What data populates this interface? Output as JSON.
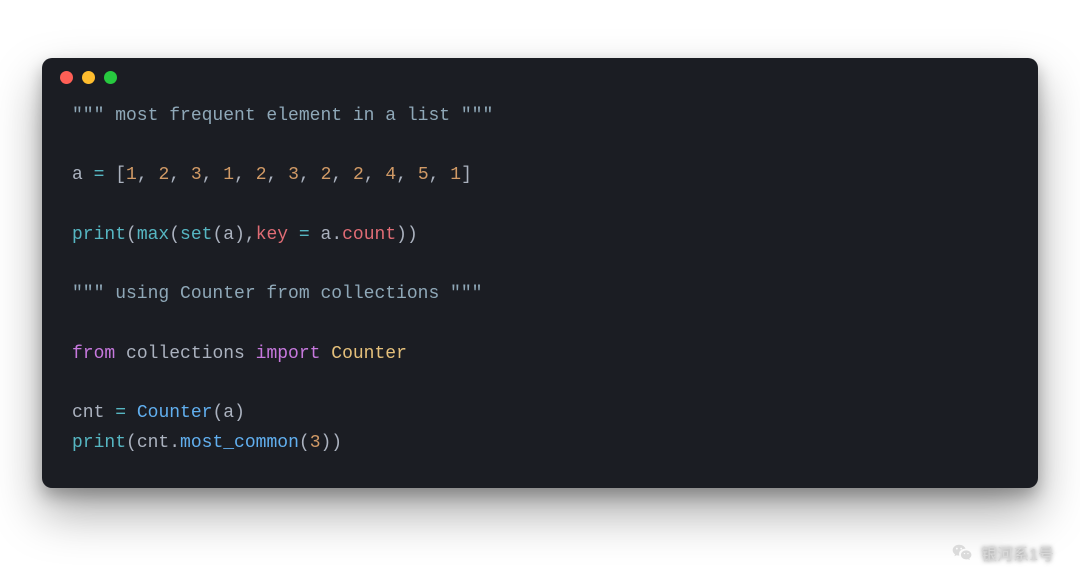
{
  "window": {
    "dots": [
      "red",
      "yellow",
      "green"
    ]
  },
  "code": {
    "lines": [
      [
        {
          "cls": "tok-string",
          "t": "\"\"\" most frequent element in a list \"\"\""
        }
      ],
      [],
      [
        {
          "cls": "tok-plain",
          "t": "a "
        },
        {
          "cls": "tok-op",
          "t": "="
        },
        {
          "cls": "tok-plain",
          "t": " ["
        },
        {
          "cls": "tok-num",
          "t": "1"
        },
        {
          "cls": "tok-plain",
          "t": ", "
        },
        {
          "cls": "tok-num",
          "t": "2"
        },
        {
          "cls": "tok-plain",
          "t": ", "
        },
        {
          "cls": "tok-num",
          "t": "3"
        },
        {
          "cls": "tok-plain",
          "t": ", "
        },
        {
          "cls": "tok-num",
          "t": "1"
        },
        {
          "cls": "tok-plain",
          "t": ", "
        },
        {
          "cls": "tok-num",
          "t": "2"
        },
        {
          "cls": "tok-plain",
          "t": ", "
        },
        {
          "cls": "tok-num",
          "t": "3"
        },
        {
          "cls": "tok-plain",
          "t": ", "
        },
        {
          "cls": "tok-num",
          "t": "2"
        },
        {
          "cls": "tok-plain",
          "t": ", "
        },
        {
          "cls": "tok-num",
          "t": "2"
        },
        {
          "cls": "tok-plain",
          "t": ", "
        },
        {
          "cls": "tok-num",
          "t": "4"
        },
        {
          "cls": "tok-plain",
          "t": ", "
        },
        {
          "cls": "tok-num",
          "t": "5"
        },
        {
          "cls": "tok-plain",
          "t": ", "
        },
        {
          "cls": "tok-num",
          "t": "1"
        },
        {
          "cls": "tok-plain",
          "t": "]"
        }
      ],
      [],
      [
        {
          "cls": "tok-builtin",
          "t": "print"
        },
        {
          "cls": "tok-punct",
          "t": "("
        },
        {
          "cls": "tok-builtin",
          "t": "max"
        },
        {
          "cls": "tok-punct",
          "t": "("
        },
        {
          "cls": "tok-builtin",
          "t": "set"
        },
        {
          "cls": "tok-punct",
          "t": "("
        },
        {
          "cls": "tok-plain",
          "t": "a"
        },
        {
          "cls": "tok-punct",
          "t": "),"
        },
        {
          "cls": "tok-ident",
          "t": "key"
        },
        {
          "cls": "tok-plain",
          "t": " "
        },
        {
          "cls": "tok-op",
          "t": "="
        },
        {
          "cls": "tok-plain",
          "t": " a."
        },
        {
          "cls": "tok-attr",
          "t": "count"
        },
        {
          "cls": "tok-punct",
          "t": "))"
        }
      ],
      [],
      [
        {
          "cls": "tok-string",
          "t": "\"\"\" using Counter from collections \"\"\""
        }
      ],
      [],
      [
        {
          "cls": "tok-keyword",
          "t": "from"
        },
        {
          "cls": "tok-plain",
          "t": " "
        },
        {
          "cls": "tok-plain",
          "t": "collections "
        },
        {
          "cls": "tok-keyword",
          "t": "import"
        },
        {
          "cls": "tok-plain",
          "t": " "
        },
        {
          "cls": "tok-yellow",
          "t": "Counter"
        }
      ],
      [],
      [
        {
          "cls": "tok-plain",
          "t": "cnt "
        },
        {
          "cls": "tok-op",
          "t": "="
        },
        {
          "cls": "tok-plain",
          "t": " "
        },
        {
          "cls": "tok-call",
          "t": "Counter"
        },
        {
          "cls": "tok-punct",
          "t": "("
        },
        {
          "cls": "tok-plain",
          "t": "a"
        },
        {
          "cls": "tok-punct",
          "t": ")"
        }
      ],
      [
        {
          "cls": "tok-builtin",
          "t": "print"
        },
        {
          "cls": "tok-punct",
          "t": "("
        },
        {
          "cls": "tok-plain",
          "t": "cnt."
        },
        {
          "cls": "tok-call",
          "t": "most_common"
        },
        {
          "cls": "tok-punct",
          "t": "("
        },
        {
          "cls": "tok-num",
          "t": "3"
        },
        {
          "cls": "tok-punct",
          "t": "))"
        }
      ]
    ]
  },
  "watermark": {
    "text": "银河系1号"
  }
}
